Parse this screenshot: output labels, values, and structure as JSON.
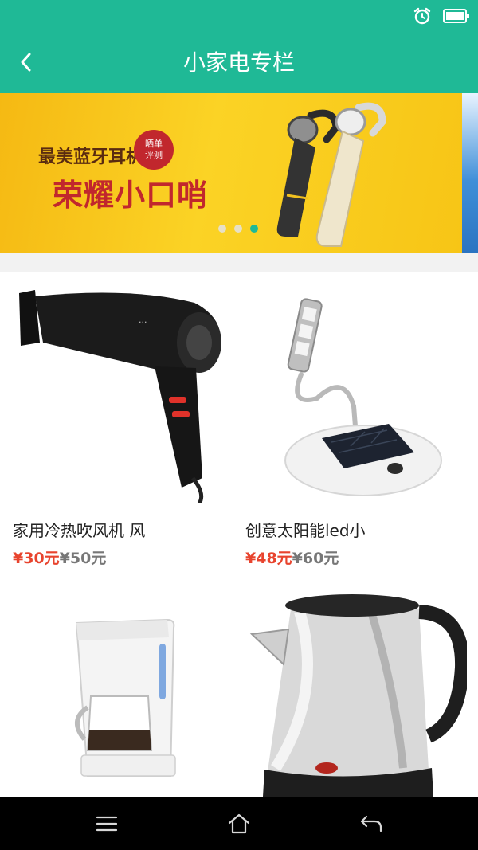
{
  "colors": {
    "accent": "#1fb996",
    "price": "#e8442e",
    "nav_bar": "#000000"
  },
  "status_bar": {
    "icons": [
      "alarm-icon",
      "battery-icon"
    ]
  },
  "header": {
    "title": "小家电专栏",
    "back_icon": "chevron-left-icon"
  },
  "banner": {
    "subtitle": "最美蓝牙耳机",
    "title": "荣耀小口哨",
    "badge_line1": "晒单",
    "badge_line2": "评测",
    "slide_count": 3,
    "active_slide": 3
  },
  "products": [
    {
      "name": "家用冷热吹风机 风",
      "price": "¥30元",
      "original_price": "¥50元",
      "image": "hair-dryer"
    },
    {
      "name": "创意太阳能led小",
      "price": "¥48元",
      "original_price": "¥60元",
      "image": "solar-led-lamp"
    },
    {
      "image": "coffee-maker"
    },
    {
      "image": "electric-kettle"
    }
  ],
  "nav_bar": {
    "icons": [
      "menu-icon",
      "home-icon",
      "back-icon"
    ]
  }
}
